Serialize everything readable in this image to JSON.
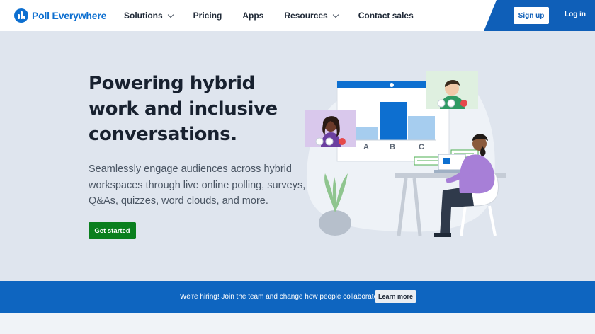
{
  "nav": {
    "brand": "Poll Everywhere",
    "links": [
      {
        "label": "Solutions",
        "has_dropdown": true
      },
      {
        "label": "Pricing",
        "has_dropdown": false
      },
      {
        "label": "Apps",
        "has_dropdown": false
      },
      {
        "label": "Resources",
        "has_dropdown": true
      },
      {
        "label": "Contact sales",
        "has_dropdown": false
      }
    ],
    "signup_label": "Sign up",
    "login_label": "Log in"
  },
  "hero": {
    "headline": "Powering hybrid work and inclusive conversations.",
    "subtext": "Seamlessly engage audiences across hybrid workspaces through live online polling, surveys, Q&As, quizzes, word clouds, and more.",
    "cta_label": "Get started",
    "chart_labels": [
      "A",
      "B",
      "C"
    ]
  },
  "banner": {
    "text": "We're hiring! Join the team and change how people collaborate.",
    "button_label": "Learn more"
  },
  "colors": {
    "brand_blue": "#0d6fd0",
    "cta_green": "#0a7f1e",
    "hero_bg": "#dfe5ee",
    "banner_blue": "#0e65c0"
  }
}
